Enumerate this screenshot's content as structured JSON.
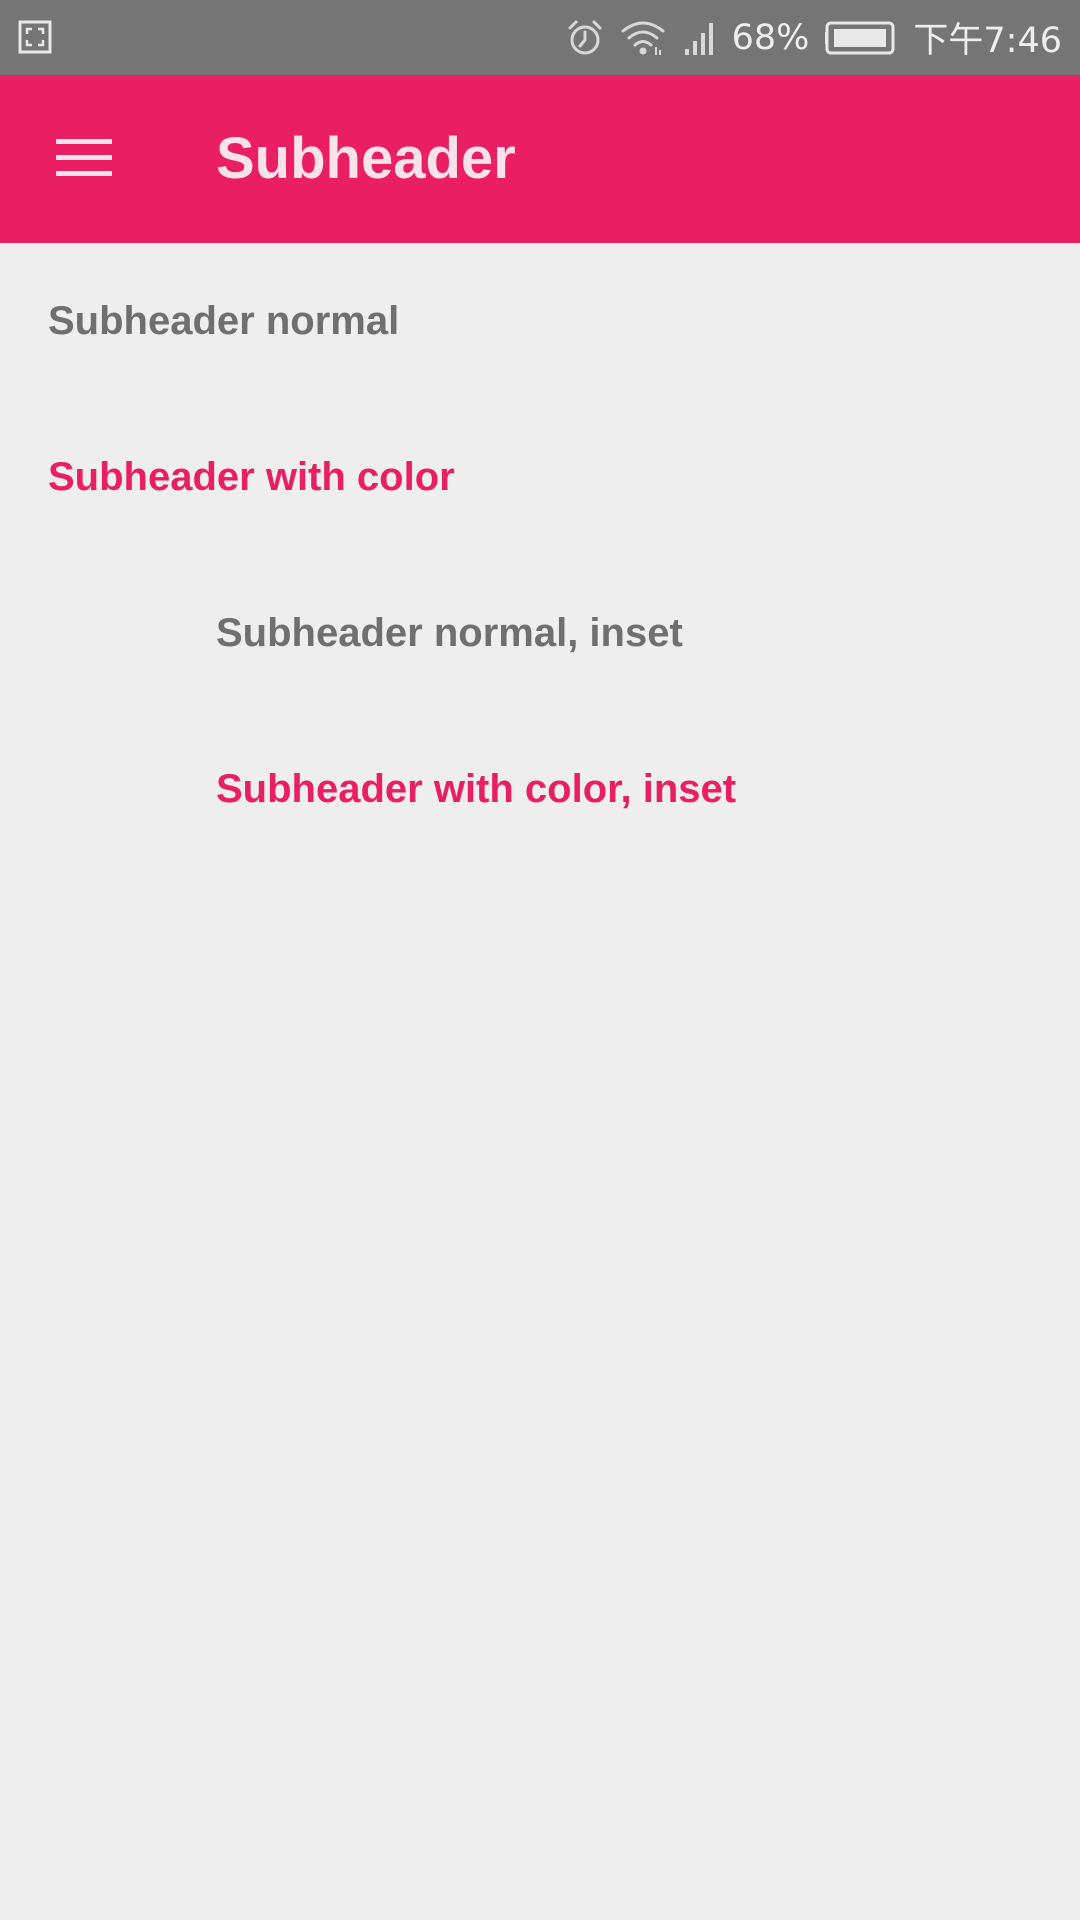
{
  "status_bar": {
    "left_icon": "screenshot-frame-icon",
    "icons": [
      "alarm-icon",
      "wifi-icon",
      "cell-signal-icon"
    ],
    "battery_percent": "68%",
    "battery_icon": "battery-icon",
    "time": "下午7:46",
    "background": "#757575"
  },
  "app_bar": {
    "menu_icon": "menu-icon",
    "title": "Subheader",
    "background": "#e91e63",
    "title_color": "#fbe1ea"
  },
  "subheaders": [
    {
      "label": "Subheader normal",
      "style": "normal",
      "inset": false
    },
    {
      "label": "Subheader with color",
      "style": "colored",
      "inset": false
    },
    {
      "label": "Subheader normal, inset",
      "style": "normal",
      "inset": true
    },
    {
      "label": "Subheader with color, inset",
      "style": "colored",
      "inset": true
    }
  ],
  "colors": {
    "accent": "#e91e63",
    "normal_text": "#6f6f6f",
    "page_background": "#eeeeee"
  }
}
